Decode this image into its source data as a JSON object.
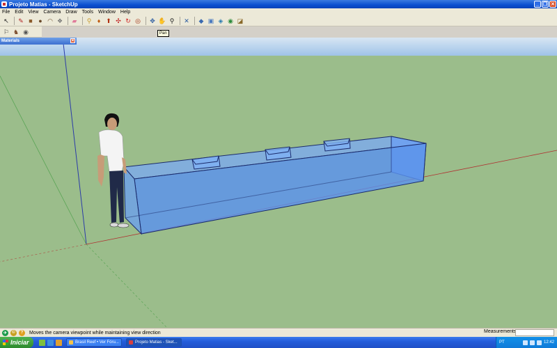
{
  "window": {
    "title": "Projeto Matias - SketchUp",
    "minimize": "_",
    "restore": "❐",
    "close": "✕"
  },
  "menu": [
    "File",
    "Edit",
    "View",
    "Camera",
    "Draw",
    "Tools",
    "Window",
    "Help"
  ],
  "toolbar": {
    "tools": [
      {
        "icon": "select-arrow-icon",
        "glyph": "↖",
        "color": "#222222"
      },
      {
        "icon": "pencil-icon",
        "glyph": "✎",
        "color": "#b02020"
      },
      {
        "icon": "rectangle-icon",
        "glyph": "■",
        "color": "#8a5a2a"
      },
      {
        "icon": "circle-icon",
        "glyph": "●",
        "color": "#6a4a2a"
      },
      {
        "icon": "arc-icon",
        "glyph": "◠",
        "color": "#6a4a2a"
      },
      {
        "icon": "make-component-icon",
        "glyph": "❖",
        "color": "#777777"
      },
      {
        "icon": "eraser-icon",
        "glyph": "▰",
        "color": "#e07a9a"
      },
      {
        "icon": "tape-measure-icon",
        "glyph": "⚲",
        "color": "#c89a2a"
      },
      {
        "icon": "paint-bucket-icon",
        "glyph": "♦",
        "color": "#c05a10"
      },
      {
        "icon": "push-pull-icon",
        "glyph": "⬆",
        "color": "#b03010"
      },
      {
        "icon": "move-icon",
        "glyph": "✣",
        "color": "#c02020"
      },
      {
        "icon": "rotate-icon",
        "glyph": "↻",
        "color": "#d02020"
      },
      {
        "icon": "offset-icon",
        "glyph": "◎",
        "color": "#a03010"
      },
      {
        "icon": "orbit-icon",
        "glyph": "✥",
        "color": "#2a5aa0"
      },
      {
        "icon": "pan-icon",
        "glyph": "✋",
        "color": "#444444"
      },
      {
        "icon": "zoom-icon",
        "glyph": "⚲",
        "color": "#1a1a1a"
      },
      {
        "icon": "zoom-extents-icon",
        "glyph": "✕",
        "color": "#2a5aa0"
      },
      {
        "icon": "get-models-icon",
        "glyph": "◆",
        "color": "#3a6ab0"
      },
      {
        "icon": "share-model-icon",
        "glyph": "▣",
        "color": "#4a7ac0"
      },
      {
        "icon": "share-component-icon",
        "glyph": "◈",
        "color": "#2a7ab0"
      },
      {
        "icon": "google-earth-icon",
        "glyph": "◉",
        "color": "#2a8a3a"
      },
      {
        "icon": "photo-textures-icon",
        "glyph": "◪",
        "color": "#8a6a2a"
      }
    ],
    "row2_tools": [
      {
        "icon": "position-camera-icon",
        "glyph": "⚐",
        "color": "#333333"
      },
      {
        "icon": "walk-icon",
        "glyph": "♞",
        "color": "#7a4a2a"
      },
      {
        "icon": "look-around-icon",
        "glyph": "◉",
        "color": "#555555"
      }
    ],
    "tooltip": "Pan"
  },
  "materials_panel": {
    "title": "Materials",
    "close": "✕"
  },
  "status": {
    "icons": [
      {
        "icon": "geolocation-icon",
        "glyph": "✈",
        "color": "#1a9a4a"
      },
      {
        "icon": "credits-icon",
        "glyph": "©",
        "color": "#c8a020"
      },
      {
        "icon": "help-icon",
        "glyph": "?",
        "color": "#e0a020"
      }
    ],
    "message": "Moves the camera viewpoint while maintaining view direction",
    "measurements_label": "Measurements",
    "measurements_value": ""
  },
  "taskbar": {
    "start": "Iniciar",
    "tasks": [
      "Brasil Reef • Ver Fóru...",
      "Projeto Matias - Sket..."
    ],
    "tray_lang": "PT",
    "clock": "12:42"
  },
  "colors": {
    "sky": "#9fc3e8",
    "ground": "#9bbd8b",
    "tank": "#5a92ee",
    "titlebar": "#0a4fd0"
  }
}
